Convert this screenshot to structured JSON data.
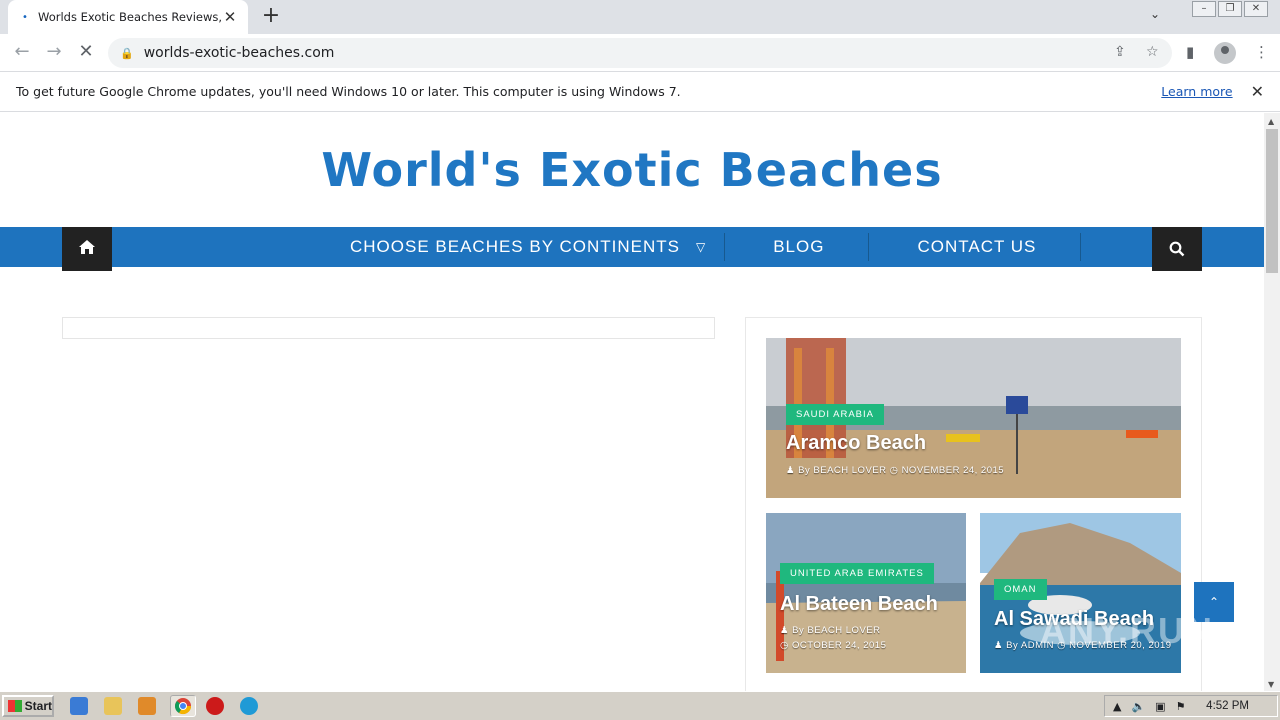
{
  "browser": {
    "tab_title": "Worlds Exotic Beaches Reviews, Tra",
    "url": "worlds-exotic-beaches.com",
    "infobar_message": "To get future Google Chrome updates, you'll need Windows 10 or later. This computer is using Windows 7.",
    "infobar_link": "Learn more"
  },
  "site": {
    "logo": "World's Exotic Beaches",
    "nav": {
      "continents": "CHOOSE BEACHES BY CONTINENTS",
      "blog": "BLOG",
      "contact": "CONTACT US"
    }
  },
  "posts": [
    {
      "category": "SAUDI ARABIA",
      "title": "Aramco Beach",
      "author": "BEACH LOVER",
      "date": "NOVEMBER 24, 2015",
      "by": "By"
    },
    {
      "category": "UNITED ARAB EMIRATES",
      "title": "Al Bateen Beach",
      "author": "BEACH LOVER",
      "date": "OCTOBER 24, 2015",
      "by": "By"
    },
    {
      "category": "OMAN",
      "title": "Al Sawadi Beach",
      "author": "ADMIN",
      "date": "NOVEMBER 20, 2019",
      "by": "By"
    }
  ],
  "taskbar": {
    "start": "Start",
    "time": "4:52 PM"
  },
  "watermark": "ANY.RUN",
  "colors": {
    "accent": "#1e73be",
    "category": "#1fb87e",
    "logo": "#2077c3"
  }
}
